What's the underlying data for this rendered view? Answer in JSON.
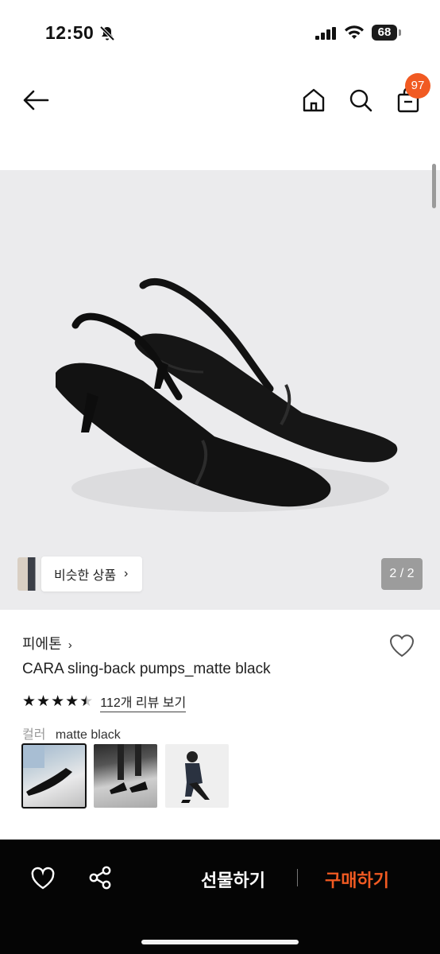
{
  "status_bar": {
    "time": "12:50",
    "battery": "68"
  },
  "header": {
    "cart_count": "97"
  },
  "gallery": {
    "similar_label": "비슷한 상품",
    "pager": "2 / 2"
  },
  "product": {
    "brand": "피에톤",
    "name": "CARA sling-back pumps_matte black",
    "rating": 4.5,
    "review_link": "112개 리뷰 보기",
    "color_label": "컬러",
    "color_value": "matte black",
    "swatch_count": 3
  },
  "bottom_bar": {
    "gift_label": "선물하기",
    "buy_label": "구매하기"
  },
  "colors": {
    "accent": "#f15a22",
    "bar": "#050505",
    "image_bg": "#ebebed"
  },
  "icons": [
    "bell-slash-icon",
    "signal-icon",
    "wifi-icon",
    "battery-icon",
    "back-arrow-icon",
    "home-icon",
    "search-icon",
    "shopping-bag-icon",
    "heart-icon",
    "share-icon",
    "chevron-right-icon",
    "star-icon"
  ]
}
